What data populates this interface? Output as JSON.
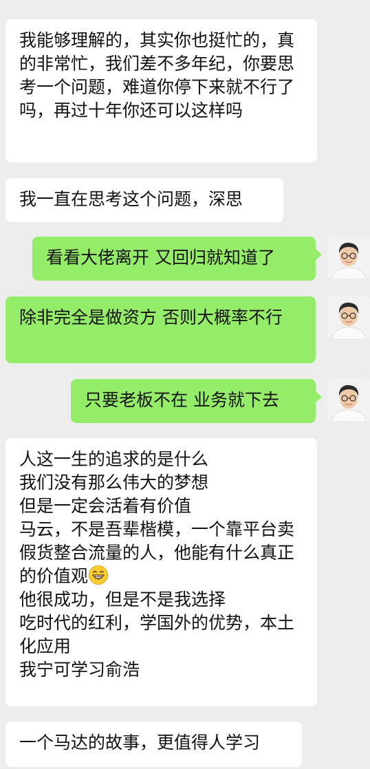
{
  "conversation": {
    "messages": [
      {
        "side": "in",
        "text": "我能够理解的，其实你也挺忙的，真的非常忙，我们差不多年纪，你要思考一个问题，难道你停下来就不行了吗，再过十年你还可以这样吗"
      },
      {
        "side": "in",
        "text": "我一直在思考这个问题，深思"
      },
      {
        "side": "out",
        "text": "看看大佬离开 又回归就知道了"
      },
      {
        "side": "out",
        "text": "除非完全是做资方 否则大概率不行"
      },
      {
        "side": "out",
        "text": "只要老板不在 业务就下去"
      },
      {
        "side": "in",
        "text_before_emoji": "人这一生的追求的是什么\n我们没有那么伟大的梦想\n但是一定会活着有价值\n马云，不是吾辈楷模，一个靠平台卖假货整合流量的人，他能有什么真正的价值观",
        "emoji": "grinning-face-icon",
        "text_after_emoji": "\n他很成功，但是不是我选择\n吃时代的红利，学国外的优势，本土化应用\n我宁可学习俞浩"
      },
      {
        "side": "in",
        "text": "一个马达的故事，更值得人学习"
      }
    ]
  },
  "colors": {
    "background": "#ededed",
    "incoming_bubble": "#ffffff",
    "outgoing_bubble": "#95ec69",
    "text": "#111111"
  }
}
